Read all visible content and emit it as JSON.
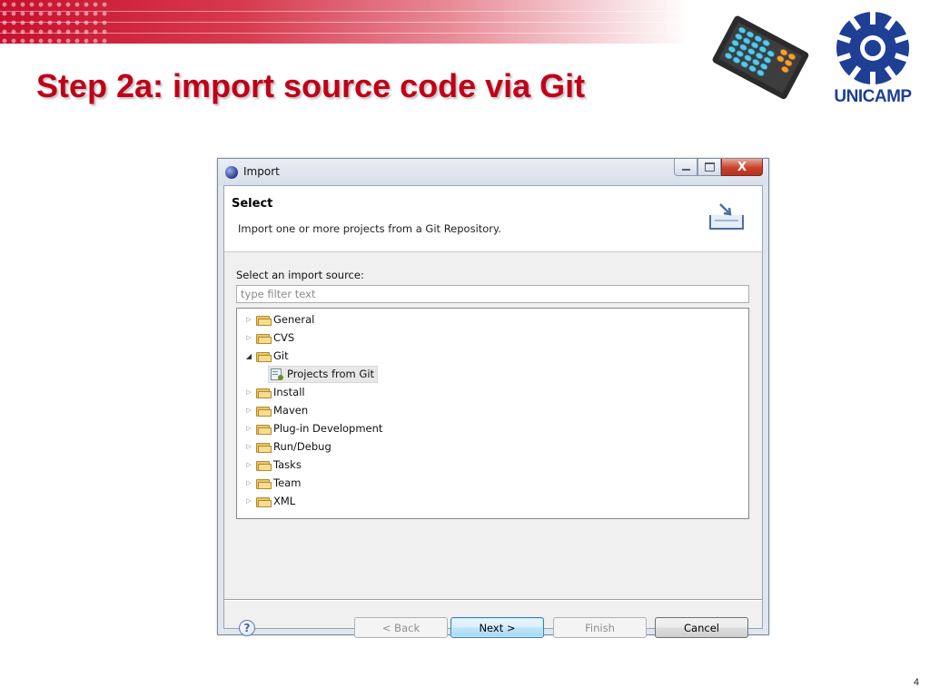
{
  "slide": {
    "title": "Step 2a: import source code via Git",
    "page_number": "4",
    "logo_text": "UNICAMP",
    "colors": {
      "title": "#c00018",
      "header_band": "#c8102e",
      "logo_blue": "#1f3f94"
    }
  },
  "dialog": {
    "window_title": "Import",
    "title_icon": "eclipse-icon",
    "banner": {
      "title": "Select",
      "description": "Import one or more projects from a Git Repository.",
      "icon": "import-wizard-icon"
    },
    "source_label": "Select an import source:",
    "filter": {
      "placeholder": "type filter text",
      "value": ""
    },
    "tree": {
      "items": [
        {
          "label": "General",
          "expanded": false
        },
        {
          "label": "CVS",
          "expanded": false
        },
        {
          "label": "Git",
          "expanded": true,
          "children": [
            {
              "label": "Projects from Git",
              "selected": true
            }
          ]
        },
        {
          "label": "Install",
          "expanded": false
        },
        {
          "label": "Maven",
          "expanded": false
        },
        {
          "label": "Plug-in Development",
          "expanded": false
        },
        {
          "label": "Run/Debug",
          "expanded": false
        },
        {
          "label": "Tasks",
          "expanded": false
        },
        {
          "label": "Team",
          "expanded": false
        },
        {
          "label": "XML",
          "expanded": false
        }
      ]
    },
    "buttons": {
      "back": "< Back",
      "next": "Next >",
      "finish": "Finish",
      "cancel": "Cancel"
    },
    "window_controls": {
      "close": "X"
    }
  }
}
